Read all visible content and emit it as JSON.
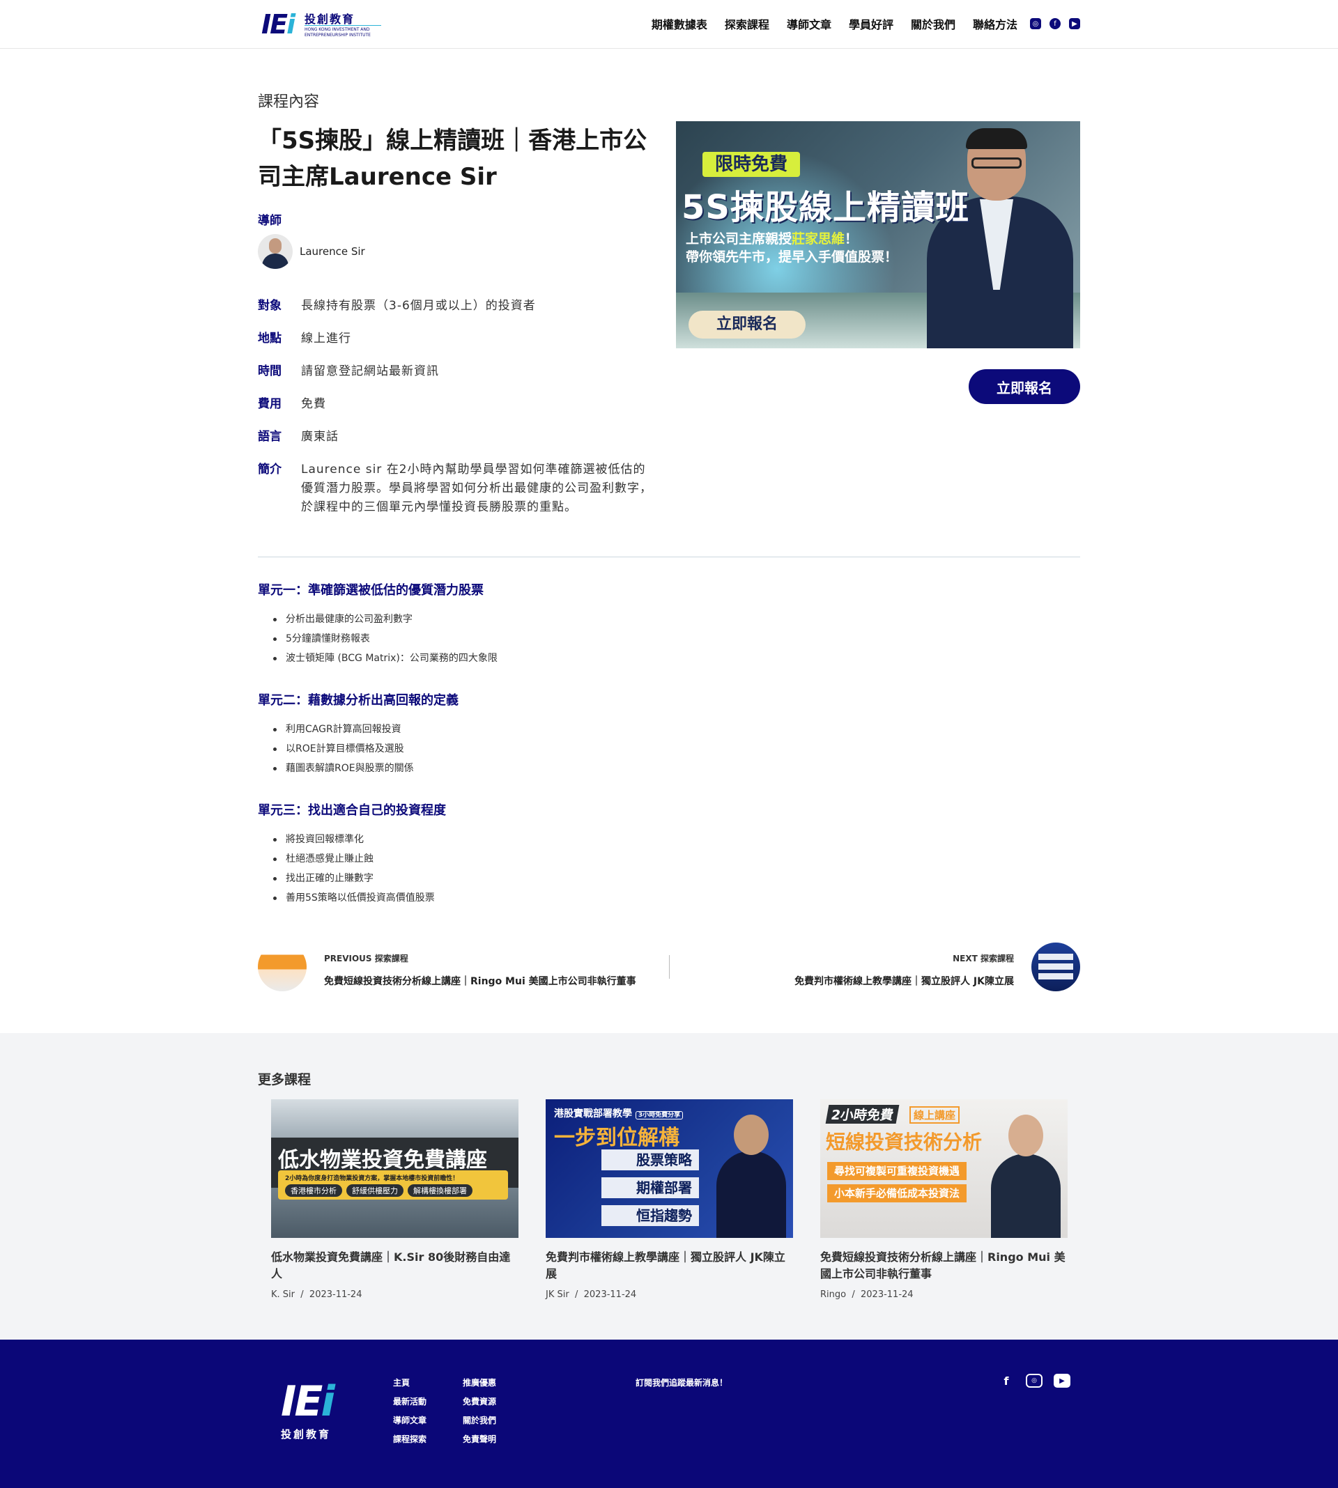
{
  "header": {
    "logo_cn": "投創教育",
    "logo_en": "HONG KONG INVESTMENT AND ENTREPRENEURSHIP INSTITUTE",
    "nav": [
      "期權數據表",
      "探索課程",
      "導師文章",
      "學員好評",
      "關於我們",
      "聯絡方法"
    ],
    "social_icons": [
      "instagram-icon",
      "facebook-icon",
      "youtube-icon"
    ]
  },
  "course": {
    "section_label": "課程內容",
    "title": "「5S揀股」線上精讀班｜香港上市公司主席Laurence Sir",
    "tutor_label": "導師",
    "tutor_name": "Laurence Sir",
    "info": [
      {
        "k": "對象",
        "v": "長線持有股票（3-6個月或以上）的投資者"
      },
      {
        "k": "地點",
        "v": "線上進行"
      },
      {
        "k": "時間",
        "v": "請留意登記網站最新資訊"
      },
      {
        "k": "費用",
        "v": "免費"
      },
      {
        "k": "語言",
        "v": "廣東話"
      },
      {
        "k": "簡介",
        "v": "Laurence sir 在2小時內幫助學員學習如何準確篩選被低估的優質潛力股票。學員將學習如何分析出最健康的公司盈利數字，於課程中的三個單元內學懂投資長勝股票的重點。"
      }
    ],
    "enroll_label": "立即報名"
  },
  "banner": {
    "tag": "限時免費",
    "headline": "5S揀股線上精讀班",
    "sub1_pre": "上市公司主席親授",
    "sub1_highlight": "莊家思維",
    "sub1_post": "！",
    "sub2": "帶你領先牛市，提早入手價值股票！",
    "cta": "立即報名"
  },
  "units": [
    {
      "title": "單元一：準確篩選被低估的優質潛力股票",
      "items": [
        "分析出最健康的公司盈利數字",
        " 5分鐘讀懂財務報表",
        "波士頓矩陣 (BCG Matrix)：公司業務的四大象限"
      ]
    },
    {
      "title": "單元二：藉數據分析出高回報的定義",
      "items": [
        "利用CAGR計算高回報投資",
        "以ROE計算目標價格及選股",
        "藉圖表解讀ROE與股票的關係"
      ]
    },
    {
      "title": "單元三：找出適合自己的投資程度",
      "items": [
        "將投資回報標準化",
        "杜絕憑感覺止賺止蝕",
        "找出正確的止賺數字",
        "善用5S策略以低價投資高價值股票"
      ]
    }
  ],
  "pagination": {
    "prev_label": "PREVIOUS 探索課程",
    "prev_title": "免費短線投資技術分析線上講座｜Ringo Mui 美國上市公司非執行董事",
    "next_label": "NEXT 探索課程",
    "next_title": "免費判市權術線上教學講座｜獨立股評人 JK陳立展"
  },
  "more": {
    "title": "更多課程",
    "cards": [
      {
        "title": "低水物業投資免費講座｜K.Sir 80後財務自由達人",
        "author": "K. Sir",
        "date": "2023-11-24",
        "img_title": "低水物業投資免費講座",
        "img_sub": "2小時為你度身打造物業投資方案，掌握本地樓市投資前瞻性！",
        "img_pills": [
          "香港樓市分析",
          "舒緩供樓壓力",
          "解構樓換樓部署"
        ]
      },
      {
        "title": "免費判市權術線上教學講座｜獨立股評人 JK陳立展",
        "author": "JK Sir",
        "date": "2023-11-24",
        "img_top": "港股實戰部署教學",
        "img_top_tag": "3小時免費分享",
        "img_title": "一步到位解構",
        "img_boxes": [
          "股票策略",
          "期權部署",
          "恒指趨勢"
        ]
      },
      {
        "title": "免費短線投資技術分析線上講座｜Ringo Mui 美國上市公司非執行董事",
        "author": "Ringo",
        "date": "2023-11-24",
        "img_tag": "2小時免費",
        "img_tag2": "線上講座",
        "img_title": "短線投資技術分析",
        "img_lines": [
          "尋找可複製可重複投資機遇",
          "小本新手必備低成本投資法"
        ]
      }
    ]
  },
  "footer": {
    "logo_cn": "投創教育",
    "col1": [
      "主頁",
      "最新活動",
      "導師文章",
      "課程探索"
    ],
    "col2": [
      "推廣優惠",
      "免費資源",
      "關於我們",
      "免責聲明"
    ],
    "subscribe": "訂閱我們追蹤最新消息！",
    "social_icons": [
      "facebook-icon",
      "instagram-icon",
      "youtube-icon"
    ]
  },
  "colors": {
    "brand": "#0c0a7a",
    "accent": "#2bb3d8",
    "footer_bg": "#0b0778"
  }
}
